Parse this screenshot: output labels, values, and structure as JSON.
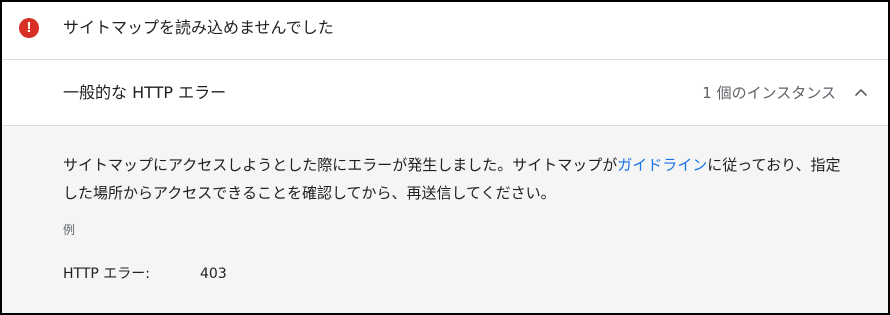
{
  "header": {
    "status_icon": "error-icon",
    "status_color": "#d93025",
    "title": "サイトマップを読み込めませんでした"
  },
  "issue": {
    "name": "一般的な HTTP エラー",
    "instance_count_label": "1 個のインスタンス",
    "toggle_icon": "chevron-up-icon",
    "expanded": true
  },
  "details": {
    "description_before_link": "サイトマップにアクセスしようとした際にエラーが発生しました。サイトマップが",
    "guideline_link": "ガイドライン",
    "description_after_link": "に従っており、指定した場所からアクセスできることを確認してから、再送信してください。",
    "example_heading": "例",
    "result_label": "HTTP エラー:",
    "result_value": "403"
  },
  "colors": {
    "link": "#1a73e8",
    "divider": "#dadce0",
    "details_background": "#f5f5f5"
  }
}
